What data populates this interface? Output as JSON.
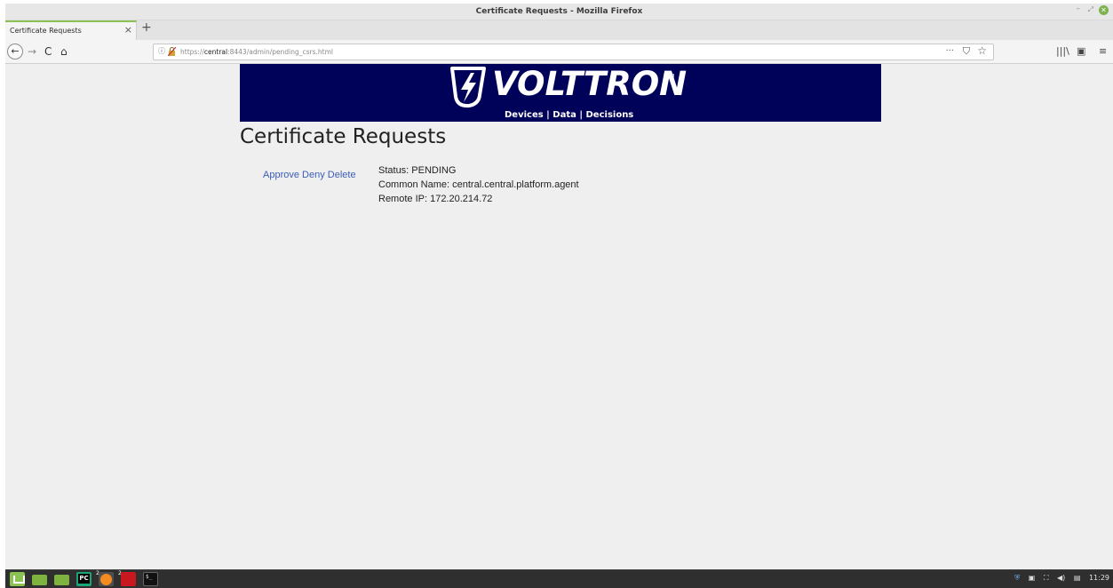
{
  "window": {
    "title": "Certificate Requests - Mozilla Firefox",
    "controls": {
      "minimize": "–",
      "maximize": "⤢",
      "close": "✕"
    }
  },
  "tabs": [
    {
      "label": "Certificate Requests",
      "close": "×"
    }
  ],
  "newtab_label": "+",
  "nav": {
    "back": "←",
    "forward": "→",
    "reload": "C",
    "home": "⌂",
    "url_scheme": "https://",
    "url_host": "central",
    "url_rest": ":8443/admin/pending_csrs.html",
    "page_actions": "···",
    "pocket": "⛉",
    "bookmark": "☆",
    "library": "|||\\",
    "sidebar_toggle": "▣",
    "menu": "≡",
    "info_icon": "ⓘ"
  },
  "banner": {
    "brand": "VOLTTRON",
    "trademark": "TM",
    "tagline": "Devices | Data | Decisions",
    "colors": {
      "background": "#000159",
      "foreground": "#ffffff"
    }
  },
  "page": {
    "title": "Certificate Requests",
    "requests": [
      {
        "actions": {
          "approve": "Approve",
          "deny": "Deny",
          "delete": "Delete"
        },
        "status": "Status: PENDING",
        "common_name": "Common Name: central.central.platform.agent",
        "remote_ip": "Remote IP: 172.20.214.72"
      }
    ],
    "link_color": "#3b5cb8"
  },
  "taskbar": {
    "icons": [
      "mint-menu-icon",
      "files-icon",
      "folder-icon",
      "pycharm-icon",
      "firefox-icon",
      "app-icon",
      "terminal-icon"
    ],
    "badges": {
      "firefox": "2",
      "app": "2"
    },
    "tray_time": "11:29"
  }
}
